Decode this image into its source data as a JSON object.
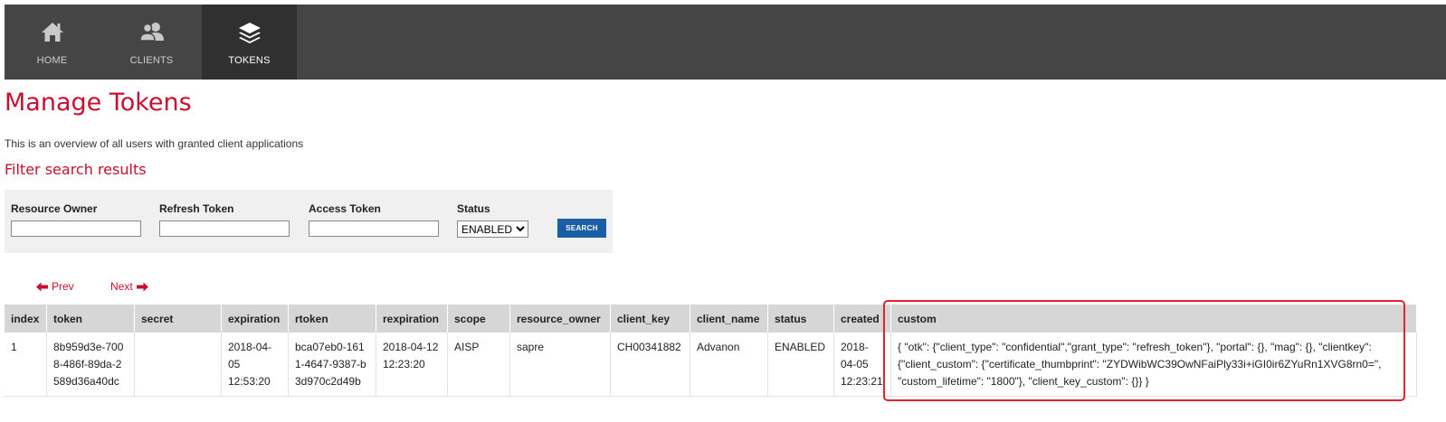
{
  "nav": {
    "items": [
      {
        "label": "HOME",
        "icon": "home-icon"
      },
      {
        "label": "CLIENTS",
        "icon": "users-icon"
      },
      {
        "label": "TOKENS",
        "icon": "layers-icon",
        "active": true
      }
    ]
  },
  "page": {
    "title": "Manage Tokens",
    "description": "This is an overview of all users with granted client applications",
    "filter_title": "Filter search results"
  },
  "filter": {
    "resource_owner_label": "Resource Owner",
    "refresh_token_label": "Refresh Token",
    "access_token_label": "Access Token",
    "status_label": "Status",
    "status_value": "ENABLED",
    "search_label": "SEARCH"
  },
  "pager": {
    "prev": "Prev",
    "next": "Next"
  },
  "table": {
    "headers": [
      "index",
      "token",
      "secret",
      "expiration",
      "rtoken",
      "rexpiration",
      "scope",
      "resource_owner",
      "client_key",
      "client_name",
      "status",
      "created",
      "custom"
    ],
    "rows": [
      {
        "index": "1",
        "token": "8b959d3e-7008-486f-89da-2589d36a40dc",
        "secret": "",
        "expiration": "2018-04-05 12:53:20",
        "rtoken": "bca07eb0-1611-4647-9387-b3d970c2d49b",
        "rexpiration": "2018-04-12 12:23:20",
        "scope": "AISP",
        "resource_owner": "sapre",
        "client_key": "CH00341882",
        "client_name": "Advanon",
        "status": "ENABLED",
        "created": "2018-04-05 12:23:21",
        "custom": "{ \"otk\": {\"client_type\": \"confidential\",\"grant_type\": \"refresh_token\"}, \"portal\": {}, \"mag\": {}, \"clientkey\": {\"client_custom\": {\"certificate_thumbprint\": \"ZYDWibWC39OwNFaiPly33i+iGI0ir6ZYuRn1XVG8rn0=\", \"custom_lifetime\": \"1800\"}, \"client_key_custom\": {}} }"
      }
    ]
  },
  "colors": {
    "accent": "#c8102e",
    "nav_bg": "#454545",
    "nav_active": "#303030",
    "button": "#1a5ea8",
    "highlight": "#e3232c"
  }
}
